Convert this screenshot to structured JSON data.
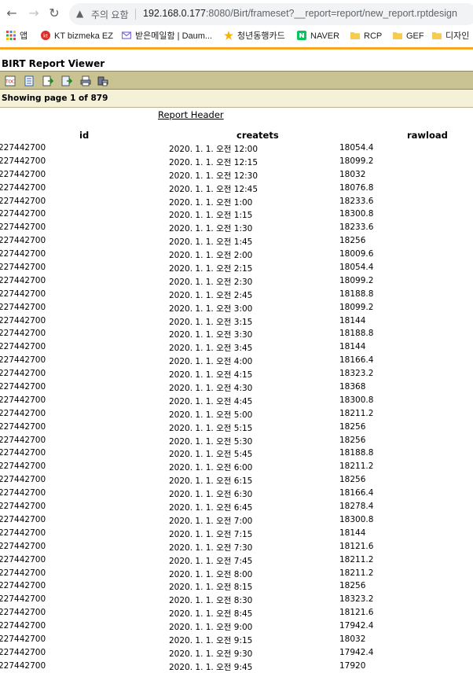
{
  "browser": {
    "warning_text": "주의 요함",
    "url_host": "192.168.0.177",
    "url_rest": ":8080/Birt/frameset?__report=report/new_report.rptdesign",
    "bookmarks": [
      {
        "label": "앱",
        "icon": "apps-grid-icon",
        "color": "#4285f4"
      },
      {
        "label": "KT bizmeka EZ",
        "icon": "kt-logo-icon",
        "color": "#d9302c"
      },
      {
        "label": "받은메일함 | Daum...",
        "icon": "mail-icon",
        "color": "#7b6cd9"
      },
      {
        "label": "청년동행카드",
        "icon": "card-icon",
        "color": "#f4b400"
      },
      {
        "label": "NAVER",
        "icon": "naver-icon",
        "color": "#03c75a"
      },
      {
        "label": "RCP",
        "icon": "folder-icon",
        "color": "#f7cb4d"
      },
      {
        "label": "GEF",
        "icon": "folder-icon",
        "color": "#f7cb4d"
      },
      {
        "label": "디자인",
        "icon": "folder-icon",
        "color": "#f7cb4d"
      }
    ]
  },
  "viewer": {
    "title": "BIRT Report Viewer",
    "page_status": "Showing page  1  of  879"
  },
  "report": {
    "header": "Report Header",
    "columns": [
      "id",
      "createts",
      "rawload"
    ],
    "rows": [
      [
        "227442700",
        "2020. 1. 1. 오전 12:00",
        "18054.4"
      ],
      [
        "227442700",
        "2020. 1. 1. 오전 12:15",
        "18099.2"
      ],
      [
        "227442700",
        "2020. 1. 1. 오전 12:30",
        "18032"
      ],
      [
        "227442700",
        "2020. 1. 1. 오전 12:45",
        "18076.8"
      ],
      [
        "227442700",
        "2020. 1. 1. 오전 1:00",
        "18233.6"
      ],
      [
        "227442700",
        "2020. 1. 1. 오전 1:15",
        "18300.8"
      ],
      [
        "227442700",
        "2020. 1. 1. 오전 1:30",
        "18233.6"
      ],
      [
        "227442700",
        "2020. 1. 1. 오전 1:45",
        "18256"
      ],
      [
        "227442700",
        "2020. 1. 1. 오전 2:00",
        "18009.6"
      ],
      [
        "227442700",
        "2020. 1. 1. 오전 2:15",
        "18054.4"
      ],
      [
        "227442700",
        "2020. 1. 1. 오전 2:30",
        "18099.2"
      ],
      [
        "227442700",
        "2020. 1. 1. 오전 2:45",
        "18188.8"
      ],
      [
        "227442700",
        "2020. 1. 1. 오전 3:00",
        "18099.2"
      ],
      [
        "227442700",
        "2020. 1. 1. 오전 3:15",
        "18144"
      ],
      [
        "227442700",
        "2020. 1. 1. 오전 3:30",
        "18188.8"
      ],
      [
        "227442700",
        "2020. 1. 1. 오전 3:45",
        "18144"
      ],
      [
        "227442700",
        "2020. 1. 1. 오전 4:00",
        "18166.4"
      ],
      [
        "227442700",
        "2020. 1. 1. 오전 4:15",
        "18323.2"
      ],
      [
        "227442700",
        "2020. 1. 1. 오전 4:30",
        "18368"
      ],
      [
        "227442700",
        "2020. 1. 1. 오전 4:45",
        "18300.8"
      ],
      [
        "227442700",
        "2020. 1. 1. 오전 5:00",
        "18211.2"
      ],
      [
        "227442700",
        "2020. 1. 1. 오전 5:15",
        "18256"
      ],
      [
        "227442700",
        "2020. 1. 1. 오전 5:30",
        "18256"
      ],
      [
        "227442700",
        "2020. 1. 1. 오전 5:45",
        "18188.8"
      ],
      [
        "227442700",
        "2020. 1. 1. 오전 6:00",
        "18211.2"
      ],
      [
        "227442700",
        "2020. 1. 1. 오전 6:15",
        "18256"
      ],
      [
        "227442700",
        "2020. 1. 1. 오전 6:30",
        "18166.4"
      ],
      [
        "227442700",
        "2020. 1. 1. 오전 6:45",
        "18278.4"
      ],
      [
        "227442700",
        "2020. 1. 1. 오전 7:00",
        "18300.8"
      ],
      [
        "227442700",
        "2020. 1. 1. 오전 7:15",
        "18144"
      ],
      [
        "227442700",
        "2020. 1. 1. 오전 7:30",
        "18121.6"
      ],
      [
        "227442700",
        "2020. 1. 1. 오전 7:45",
        "18211.2"
      ],
      [
        "227442700",
        "2020. 1. 1. 오전 8:00",
        "18211.2"
      ],
      [
        "227442700",
        "2020. 1. 1. 오전 8:15",
        "18256"
      ],
      [
        "227442700",
        "2020. 1. 1. 오전 8:30",
        "18323.2"
      ],
      [
        "227442700",
        "2020. 1. 1. 오전 8:45",
        "18121.6"
      ],
      [
        "227442700",
        "2020. 1. 1. 오전 9:00",
        "17942.4"
      ],
      [
        "227442700",
        "2020. 1. 1. 오전 9:15",
        "18032"
      ],
      [
        "227442700",
        "2020. 1. 1. 오전 9:30",
        "17942.4"
      ],
      [
        "227442700",
        "2020. 1. 1. 오전 9:45",
        "17920"
      ]
    ]
  }
}
